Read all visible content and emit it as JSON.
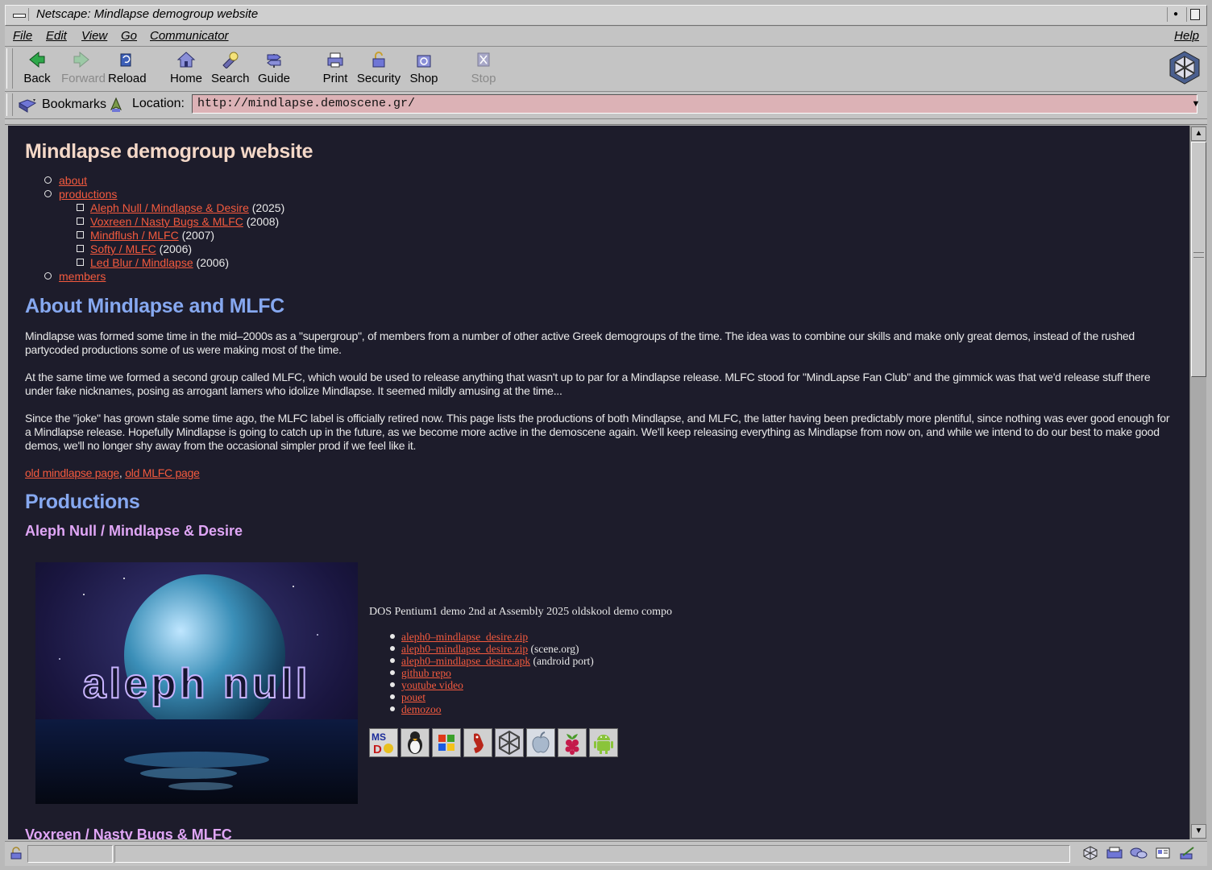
{
  "window": {
    "title": "Netscape: Mindlapse demogroup website"
  },
  "menubar": {
    "items": [
      "File",
      "Edit",
      "View",
      "Go",
      "Communicator"
    ],
    "help": "Help"
  },
  "toolbar": {
    "back": "Back",
    "forward": "Forward",
    "reload": "Reload",
    "home": "Home",
    "search": "Search",
    "guide": "Guide",
    "print": "Print",
    "security": "Security",
    "shop": "Shop",
    "stop": "Stop"
  },
  "location": {
    "bookmarks_label": "Bookmarks",
    "label": "Location:",
    "url": "http://mindlapse.demoscene.gr/"
  },
  "status": {
    "text": ""
  },
  "page": {
    "title": "Mindlapse demogroup website",
    "toc": {
      "about": "about",
      "productions": "productions",
      "members": "members",
      "prods": [
        {
          "link": "Aleph Null / Mindlapse & Desire",
          "year": " (2025)"
        },
        {
          "link": "Voxreen / Nasty Bugs & MLFC",
          "year": " (2008)"
        },
        {
          "link": "Mindflush / MLFC",
          "year": " (2007)"
        },
        {
          "link": "Softy / MLFC",
          "year": " (2006)"
        },
        {
          "link": "Led Blur / Mindlapse",
          "year": " (2006)"
        }
      ]
    },
    "about_heading": "About Mindlapse and MLFC",
    "para1": "Mindlapse was formed some time in the mid–2000s as a \"supergroup\", of members from a number of other active Greek demogroups of the time. The idea was to combine our skills and make only great demos, instead of the rushed partycoded productions some of us were making most of the time.",
    "para2": "At the same time we formed a second group called MLFC, which would be used to release anything that wasn't up to par for a Mindlapse release. MLFC stood for \"MindLapse Fan Club\" and the gimmick was that we'd release stuff there under fake nicknames, posing as arrogant lamers who idolize Mindlapse. It seemed mildly amusing at the time...",
    "para3": "Since the \"joke\" has grown stale some time ago, the MLFC label is officially retired now. This page lists the productions of both Mindlapse, and MLFC, the latter having been predictably more plentiful, since nothing was ever good enough for a Mindlapse release. Hopefully Mindlapse is going to catch up in the future, as we become more active in the demoscene again. We'll keep releasing everything as Mindlapse from now on, and while we intend to do our best to make good demos, we'll no longer shy away from the occasional simpler prod if we feel like it.",
    "old_link1": "old mindlapse page",
    "link_sep": ", ",
    "old_link2": "old MLFC page",
    "productions_heading": "Productions",
    "prod1": {
      "title": "Aleph Null / Mindlapse & Desire",
      "image_logo_text": "aleph null",
      "description": "DOS Pentium1 demo 2nd at Assembly 2025 oldskool demo compo",
      "downloads": [
        {
          "link": "aleph0–mindlapse_desire.zip",
          "note": ""
        },
        {
          "link": "aleph0–mindlapse_desire.zip",
          "note": " (scene.org)"
        },
        {
          "link": "aleph0–mindlapse_desire.apk",
          "note": " (android port)"
        },
        {
          "link": "github repo",
          "note": ""
        },
        {
          "link": "youtube video",
          "note": ""
        },
        {
          "link": "pouet",
          "note": ""
        },
        {
          "link": "demozoo",
          "note": ""
        }
      ],
      "platforms": [
        "ms-dos-icon",
        "linux-icon",
        "windows-icon",
        "freebsd-icon",
        "irix-icon",
        "macos-icon",
        "raspberry-pi-icon",
        "android-icon"
      ]
    },
    "prod2": {
      "title": "Voxreen / Nasty Bugs & MLFC"
    }
  },
  "colors": {
    "page_bg": "#1d1c2b",
    "link": "#f45a3e",
    "heading_title": "#f4d8c8",
    "heading_section": "#86a8f0",
    "heading_prod": "#e0a6f6",
    "location_bg": "#dcb2b6"
  }
}
